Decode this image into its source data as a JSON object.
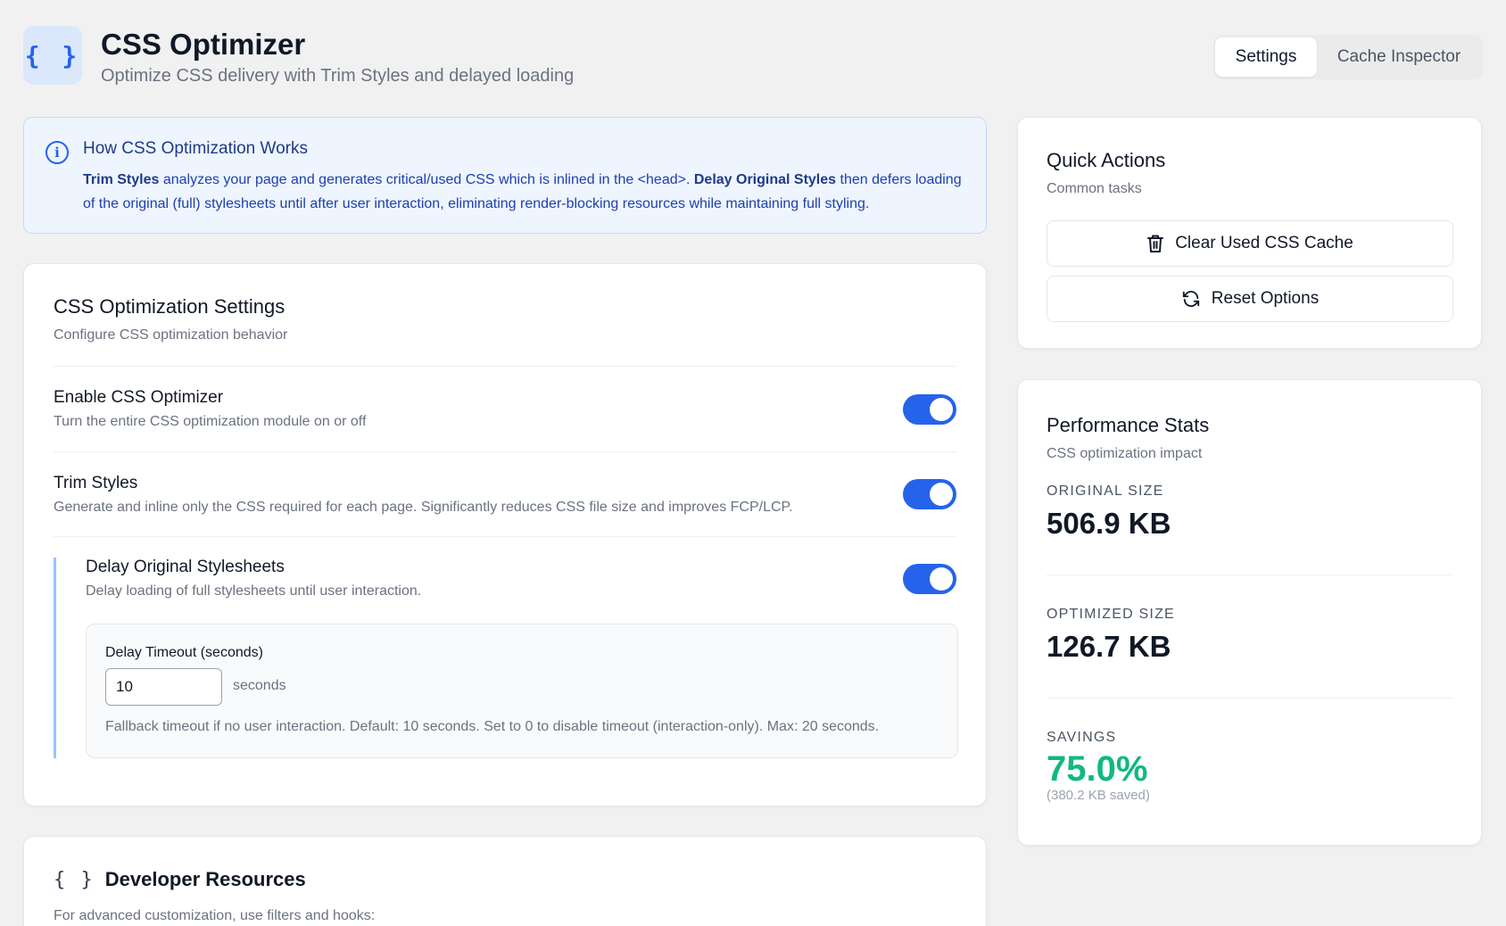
{
  "header": {
    "logo_glyph": "{ }",
    "title": "CSS Optimizer",
    "subtitle": "Optimize CSS delivery with Trim Styles and delayed loading",
    "tabs": [
      {
        "label": "Settings",
        "active": true
      },
      {
        "label": "Cache Inspector",
        "active": false
      }
    ]
  },
  "info": {
    "icon": "info-icon",
    "title": "How CSS Optimization Works",
    "text_part1_bold": "Trim Styles",
    "text_part2": " analyzes your page and generates critical/used CSS which is inlined in the <head>. ",
    "text_part3_bold": "Delay Original Styles",
    "text_part4": " then defers loading of the original (full) stylesheets until after user interaction, eliminating render-blocking resources while maintaining full styling."
  },
  "settings": {
    "title": "CSS Optimization Settings",
    "subtitle": "Configure CSS optimization behavior",
    "rows": [
      {
        "title": "Enable CSS Optimizer",
        "desc": "Turn the entire CSS optimization module on or off",
        "enabled": true
      },
      {
        "title": "Trim Styles",
        "desc": "Generate and inline only the CSS required for each page. Significantly reduces CSS file size and improves FCP/LCP.",
        "enabled": true
      }
    ],
    "delay": {
      "title": "Delay Original Stylesheets",
      "desc": "Delay loading of full stylesheets until user interaction.",
      "enabled": true,
      "timeout_label": "Delay Timeout (seconds)",
      "timeout_value": "10",
      "timeout_unit": "seconds",
      "timeout_help": "Fallback timeout if no user interaction. Default: 10 seconds. Set to 0 to disable timeout (interaction-only). Max: 20 seconds."
    }
  },
  "developer": {
    "icon_glyph": "{ }",
    "title": "Developer Resources",
    "subtitle": "For advanced customization, use filters and hooks:"
  },
  "quick_actions": {
    "title": "Quick Actions",
    "subtitle": "Common tasks",
    "buttons": [
      {
        "label": "Clear Used CSS Cache",
        "icon": "trash-icon"
      },
      {
        "label": "Reset Options",
        "icon": "refresh-icon"
      }
    ]
  },
  "performance": {
    "title": "Performance Stats",
    "subtitle": "CSS optimization impact",
    "original_label": "Original Size",
    "original_value": "506.9 KB",
    "optimized_label": "Optimized Size",
    "optimized_value": "126.7 KB",
    "savings_label": "Savings",
    "savings_value": "75.0%",
    "savings_note": "(380.2 KB saved)"
  },
  "colors": {
    "accent": "#2563eb",
    "success": "#10b981",
    "info_bg": "#eef5fe",
    "background": "#f1f1f2"
  }
}
